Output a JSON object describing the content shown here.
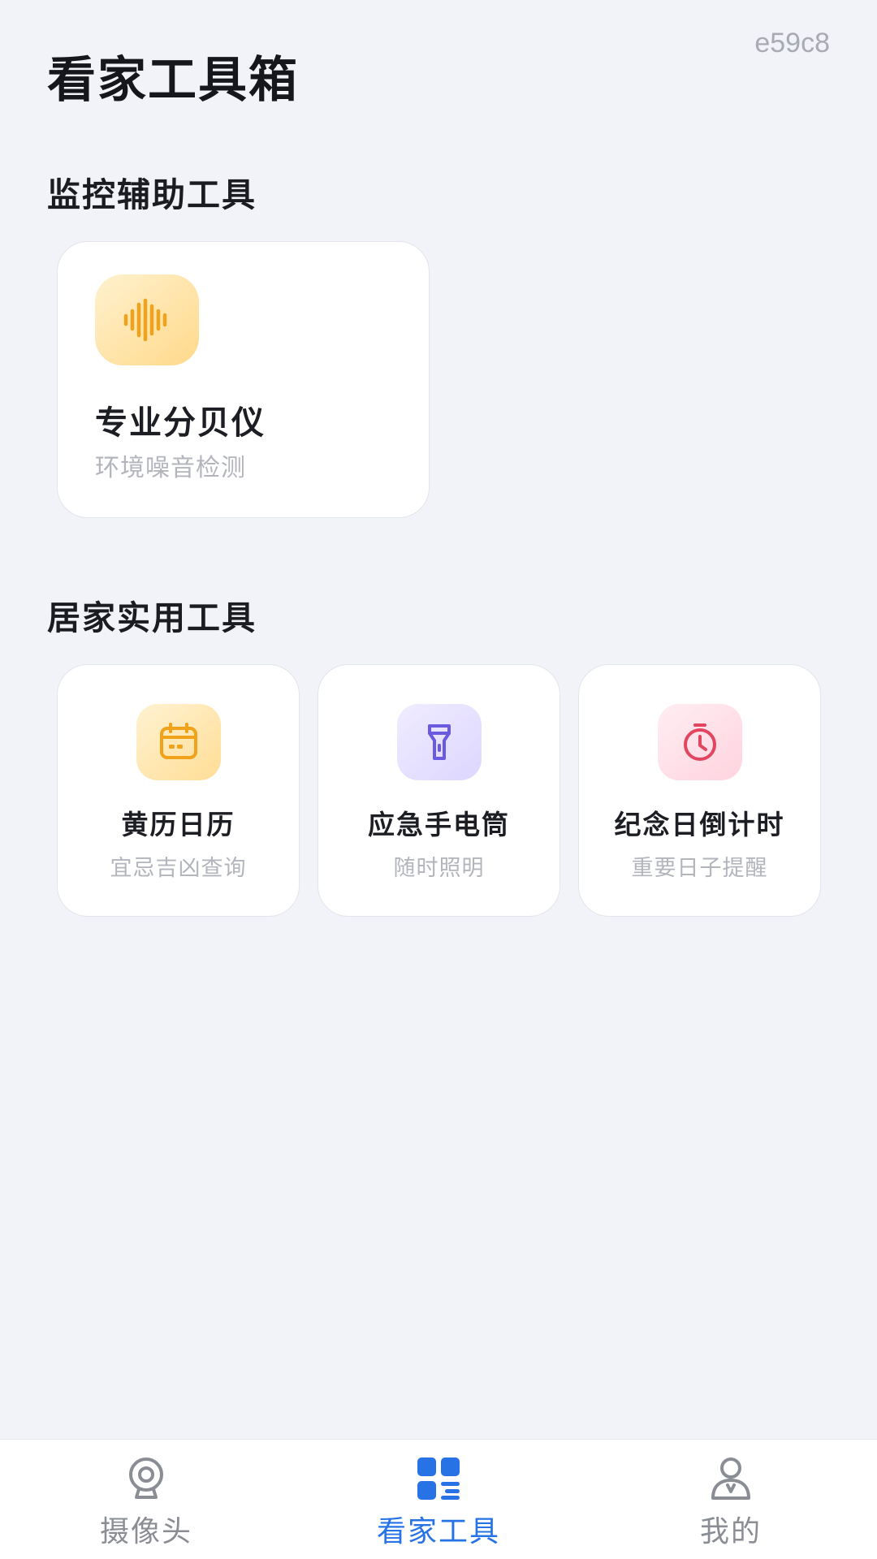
{
  "header": {
    "title": "看家工具箱",
    "build_id": "e59c8"
  },
  "sections": [
    {
      "title": "监控辅助工具",
      "cards": [
        {
          "title": "专业分贝仪",
          "subtitle": "环境噪音检测",
          "icon": "sound-wave-icon"
        }
      ]
    },
    {
      "title": "居家实用工具",
      "cards": [
        {
          "title": "黄历日历",
          "subtitle": "宜忌吉凶查询",
          "icon": "calendar-icon"
        },
        {
          "title": "应急手电筒",
          "subtitle": "随时照明",
          "icon": "flashlight-icon"
        },
        {
          "title": "纪念日倒计时",
          "subtitle": "重要日子提醒",
          "icon": "stopwatch-icon"
        }
      ]
    }
  ],
  "tabbar": {
    "active_index": 1,
    "items": [
      {
        "label": "摄像头",
        "icon": "camera-icon"
      },
      {
        "label": "看家工具",
        "icon": "grid-icon"
      },
      {
        "label": "我的",
        "icon": "user-icon"
      }
    ]
  },
  "colors": {
    "background": "#f2f3f8",
    "accent": "#2773e6",
    "sound_icon": "#f0a21b",
    "calendar_icon": "#f0a21b",
    "flashlight_icon": "#6a5ae0",
    "stopwatch_icon": "#e2455f"
  }
}
